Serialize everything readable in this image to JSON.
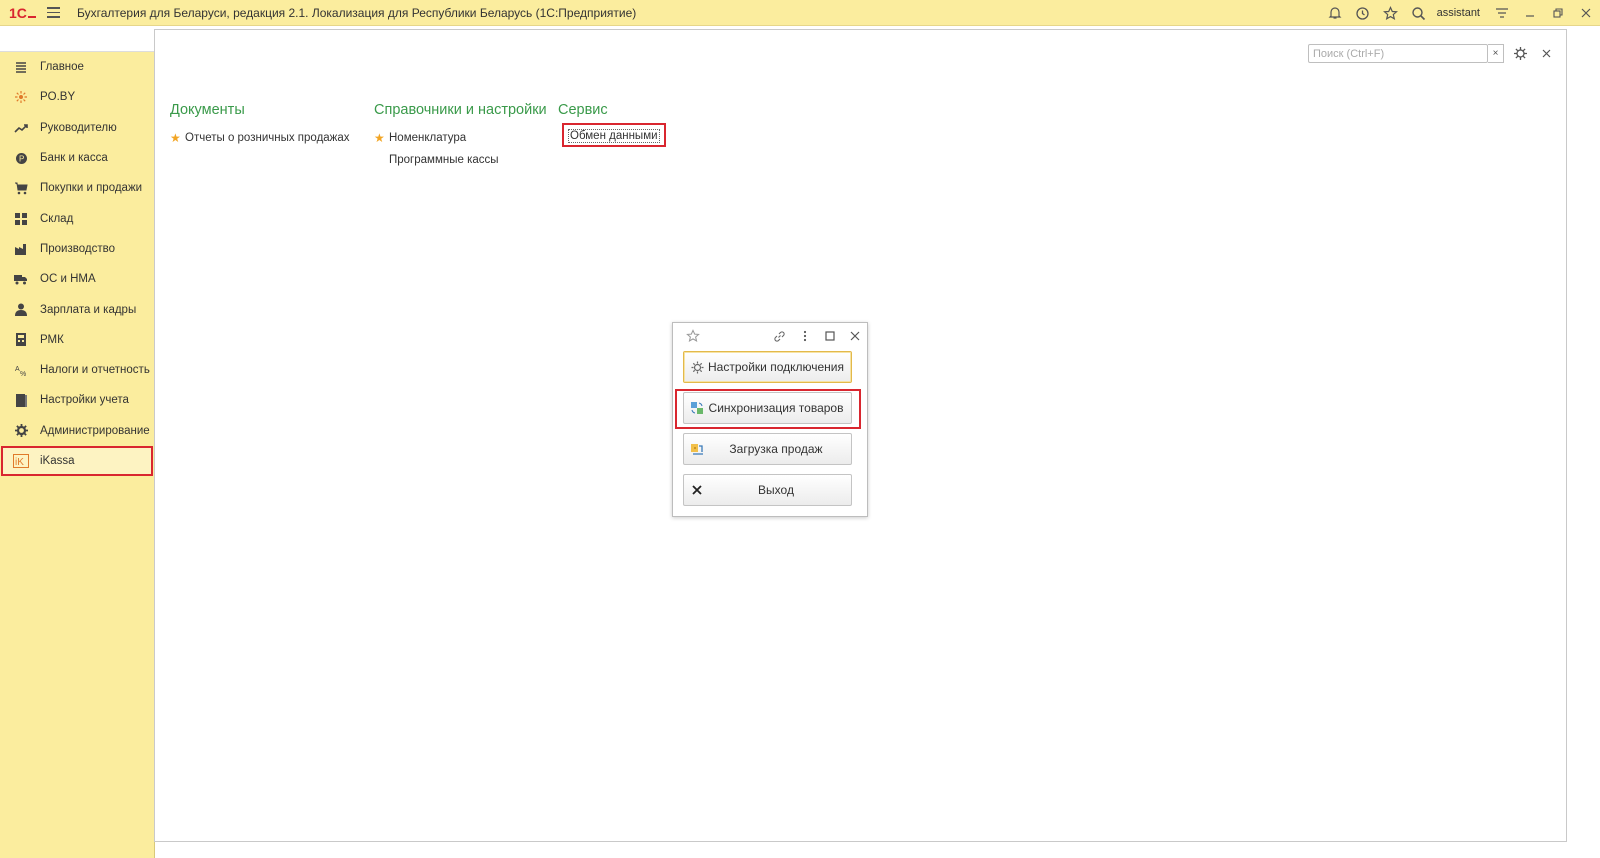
{
  "titlebar": {
    "title": "Бухгалтерия для Беларуси, редакция 2.1. Локализация для Республики Беларусь   (1С:Предприятие)",
    "user": "assistant",
    "icons": [
      "bell-icon",
      "history-icon",
      "star-icon",
      "search-icon",
      "settings-menu-icon",
      "minimize-icon",
      "restore-icon",
      "close-icon"
    ]
  },
  "sidebar": {
    "items": [
      {
        "label": "Главное",
        "icon": "list-icon"
      },
      {
        "label": "PO.BY",
        "icon": "sun-icon"
      },
      {
        "label": "Руководителю",
        "icon": "trend-icon"
      },
      {
        "label": "Банк и касса",
        "icon": "coin-icon"
      },
      {
        "label": "Покупки и продажи",
        "icon": "cart-icon"
      },
      {
        "label": "Склад",
        "icon": "grid-icon"
      },
      {
        "label": "Производство",
        "icon": "factory-icon"
      },
      {
        "label": "ОС и НМА",
        "icon": "truck-icon"
      },
      {
        "label": "Зарплата и кадры",
        "icon": "person-icon"
      },
      {
        "label": "РМК",
        "icon": "register-icon"
      },
      {
        "label": "Налоги и отчетность",
        "icon": "tax-icon"
      },
      {
        "label": "Настройки учета",
        "icon": "book-icon"
      },
      {
        "label": "Администрирование",
        "icon": "gear-icon"
      },
      {
        "label": "iKassa",
        "icon": "ikassa-icon"
      }
    ],
    "selected": "iKassa"
  },
  "main": {
    "search": {
      "placeholder": "Поиск (Ctrl+F)"
    },
    "sections": [
      {
        "title": "Документы",
        "links": [
          {
            "label": "Отчеты о розничных продажах",
            "starred": true
          }
        ]
      },
      {
        "title": "Справочники и настройки",
        "links": [
          {
            "label": "Номенклатура",
            "starred": true
          },
          {
            "label": "Программные кассы",
            "starred": false
          }
        ]
      },
      {
        "title": "Сервис",
        "links": [
          {
            "label": "Обмен данными",
            "starred": false
          }
        ]
      }
    ]
  },
  "dialog": {
    "buttons": [
      {
        "label": "Настройки подключения",
        "icon": "gear-icon"
      },
      {
        "label": "Синхронизация товаров",
        "icon": "sync-icon"
      },
      {
        "label": "Загрузка продаж",
        "icon": "upload-icon"
      },
      {
        "label": "Выход",
        "icon": "close-icon"
      }
    ]
  },
  "colors": {
    "sidebar_bg": "#fbed9e",
    "accent_green": "#3a9a4a",
    "highlight_red": "#d9262f",
    "star": "#f2a524"
  }
}
